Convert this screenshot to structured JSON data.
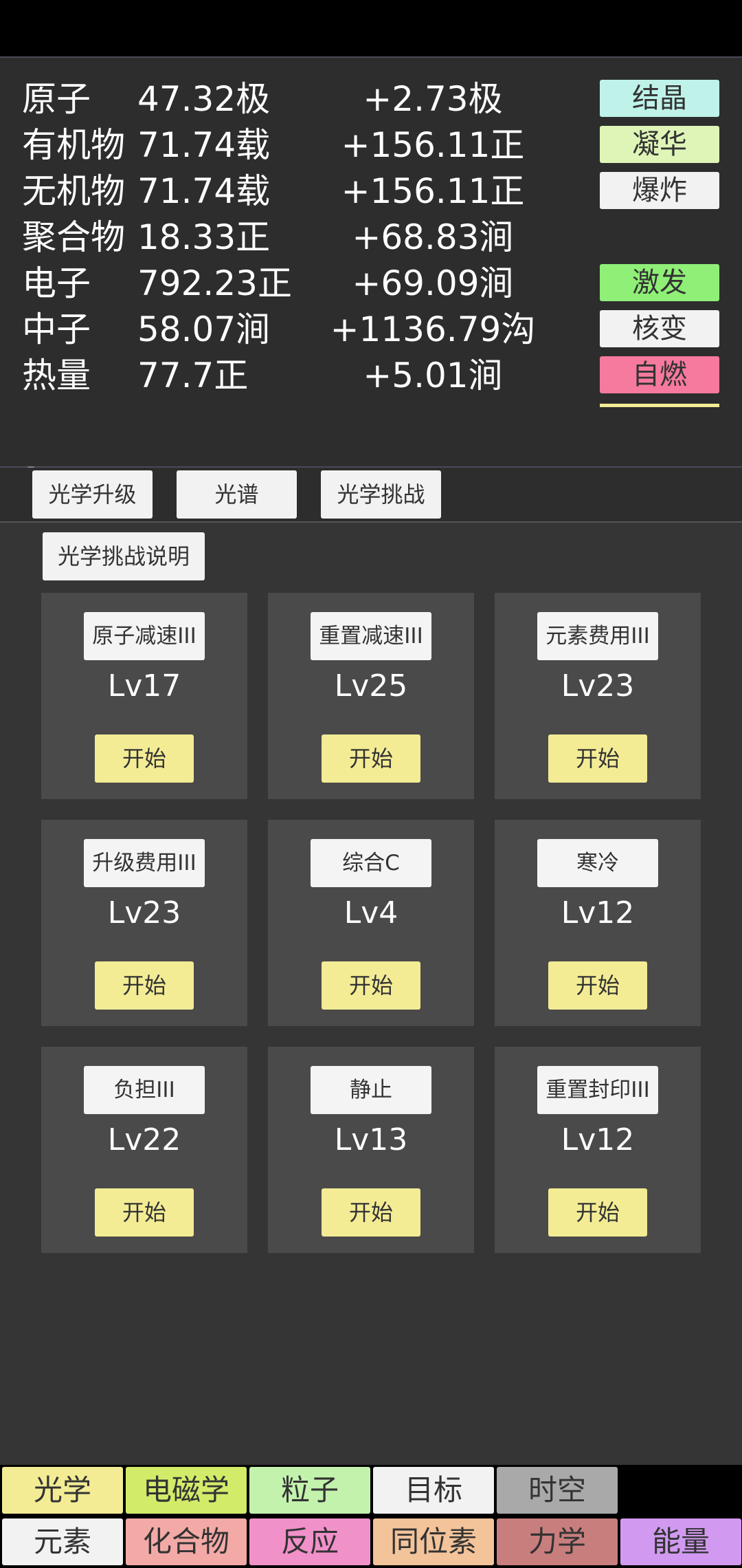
{
  "resources": [
    {
      "name": "原子",
      "amount": "47.32极",
      "rate": "+2.73极"
    },
    {
      "name": "有机物",
      "amount": "71.74载",
      "rate": "+156.11正"
    },
    {
      "name": "无机物",
      "amount": "71.74载",
      "rate": "+156.11正"
    },
    {
      "name": "聚合物",
      "amount": "18.33正",
      "rate": "+68.83涧"
    },
    {
      "name": "电子",
      "amount": "792.23正",
      "rate": "+69.09涧"
    },
    {
      "name": "中子",
      "amount": "58.07涧",
      "rate": "+1136.79沟"
    },
    {
      "name": "热量",
      "amount": "77.7正",
      "rate": "+5.01涧"
    }
  ],
  "actions": [
    {
      "label": "结晶",
      "color": "#bff3ea"
    },
    {
      "label": "凝华",
      "color": "#dff5b8"
    },
    {
      "label": "爆炸",
      "color": "#f2f2f2"
    },
    {
      "label": "激发",
      "color": "#8fef77"
    },
    {
      "label": "核变",
      "color": "#f2f2f2"
    },
    {
      "label": "自燃",
      "color": "#f6799e"
    }
  ],
  "icons": {
    "settings": "gear-icon",
    "shuffle": "shuffle-icon"
  },
  "subtabs": [
    "光学升级",
    "光谱",
    "光学挑战"
  ],
  "challenge_info_label": "光学挑战说明",
  "challenges": [
    {
      "name": "原子减速III",
      "level": "Lv17",
      "start": "开始"
    },
    {
      "name": "重置减速III",
      "level": "Lv25",
      "start": "开始"
    },
    {
      "name": "元素费用III",
      "level": "Lv23",
      "start": "开始"
    },
    {
      "name": "升级费用III",
      "level": "Lv23",
      "start": "开始"
    },
    {
      "name": "综合C",
      "level": "Lv4",
      "start": "开始"
    },
    {
      "name": "寒冷",
      "level": "Lv12",
      "start": "开始"
    },
    {
      "name": "负担III",
      "level": "Lv22",
      "start": "开始"
    },
    {
      "name": "静止",
      "level": "Lv13",
      "start": "开始"
    },
    {
      "name": "重置封印III",
      "level": "Lv12",
      "start": "开始"
    }
  ],
  "nav_row1": [
    {
      "label": "光学",
      "color": "#f3ec95"
    },
    {
      "label": "电磁学",
      "color": "#d2ec6a"
    },
    {
      "label": "粒子",
      "color": "#c3f2ad"
    },
    {
      "label": "目标",
      "color": "#f2f2f2"
    },
    {
      "label": "时空",
      "color": "#a9a9a9"
    }
  ],
  "nav_row2": [
    {
      "label": "元素",
      "color": "#f2f2f2"
    },
    {
      "label": "化合物",
      "color": "#f3aaa7"
    },
    {
      "label": "反应",
      "color": "#f191c9"
    },
    {
      "label": "同位素",
      "color": "#f3c39a"
    },
    {
      "label": "力学",
      "color": "#c97e7e"
    },
    {
      "label": "能量",
      "color": "#d19af0"
    }
  ]
}
